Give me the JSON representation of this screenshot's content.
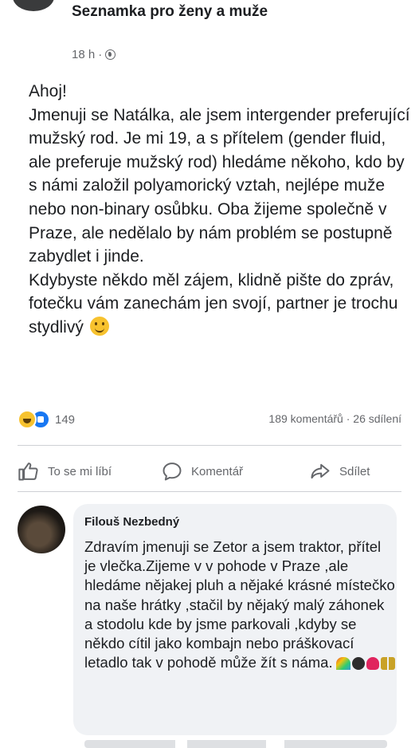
{
  "post": {
    "group_name": "Seznamka pro ženy a muže",
    "time": "18 h",
    "separator": "·",
    "privacy_icon": "globe-icon",
    "body": "Ahoj!\nJmenuji se Natálka, ale jsem intergender preferující mužský rod. Je mi 19, a s přítelem (gender fluid, ale preferuje mužský rod) hledáme někoho, kdo by s námi založil polyamorický vztah, nejlépe muže nebo non-binary osůbku. Oba žijeme společně v Praze, ale nedělalo by nám problém se postupně zabydlet i jinde.\nKdybyste někdo měl zájem, klidně pište do zpráv, fotečku vám zanechám jen svojí, partner je trochu stydlivý",
    "body_emoji": "grinning-face-icon"
  },
  "stats": {
    "reaction_count": "149",
    "comments": "189 komentářů",
    "dot": "·",
    "shares": "26 sdílení",
    "reaction_icons": [
      "haha-reaction-icon",
      "like-reaction-icon"
    ]
  },
  "actions": {
    "like": "To se mi líbí",
    "comment": "Komentář",
    "share": "Sdílet"
  },
  "comment": {
    "author": "Filouš Nezbedný",
    "text": "Zdravím jmenuji se Zetor a jsem traktor, přítel je vlečka.Zijeme v v pohode v Praze ,ale hledáme nějakej pluh a nějaké krásné místečko na naše hrátky ,stačil by nějaký malý záhonek a stodolu kde by jsme parkovali ,kdyby  se někdo cítil jako kombajn nebo práškovací letadlo tak v pohodě může žít s náma.",
    "trailing_emojis": [
      "rainbow-icon",
      "tractor-icon",
      "heart-icon",
      "people-icon"
    ]
  },
  "colors": {
    "text": "#1c1e21",
    "secondary": "#65676b",
    "bubble": "#f0f2f5",
    "like_blue": "#1877f2"
  }
}
